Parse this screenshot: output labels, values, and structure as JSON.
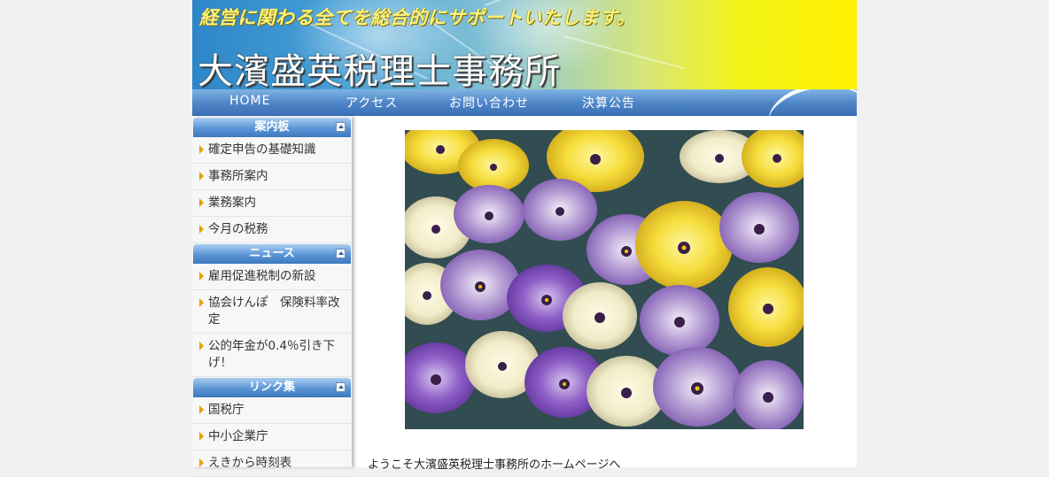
{
  "header": {
    "tagline": "経営に関わる全てを総合的にサポートいたします。",
    "office_name": "大濱盛英税理士事務所"
  },
  "nav": {
    "items": [
      {
        "label": "HOME"
      },
      {
        "label": "アクセス"
      },
      {
        "label": "お問い合わせ"
      },
      {
        "label": "決算公告"
      }
    ]
  },
  "sidebar": {
    "sections": [
      {
        "title": "案内板",
        "items": [
          {
            "label": "確定申告の基礎知識"
          },
          {
            "label": "事務所案内"
          },
          {
            "label": "業務案内"
          },
          {
            "label": "今月の税務"
          }
        ]
      },
      {
        "title": "ニュース",
        "items": [
          {
            "label": "雇用促進税制の新設"
          },
          {
            "label": "協会けんぽ　保険料率改定"
          },
          {
            "label": "公的年金が0.4％引き下げ！"
          }
        ]
      },
      {
        "title": "リンク集",
        "items": [
          {
            "label": "国税庁"
          },
          {
            "label": "中小企業庁"
          },
          {
            "label": "えきから時刻表"
          }
        ]
      }
    ]
  },
  "main": {
    "welcome_text": "ようこそ大濱盛英税理士事務所のホームページへ"
  }
}
